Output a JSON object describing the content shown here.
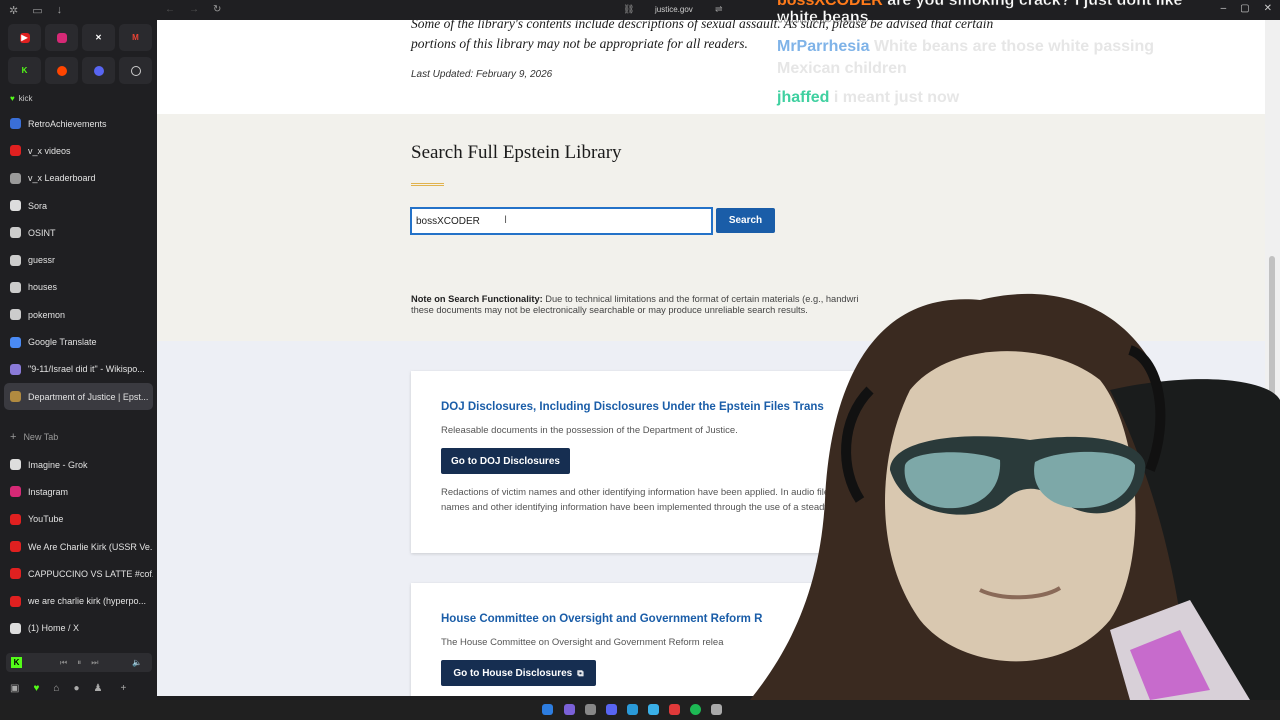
{
  "browser": {
    "url": "justice.gov"
  },
  "sidebar": {
    "kick_label": "kick",
    "tabs": [
      {
        "label": "RetroAchievements",
        "icon": "retroachievements-icon",
        "color": "#3a6fd8"
      },
      {
        "label": "v_x videos",
        "icon": "youtube-icon",
        "color": "#e02020"
      },
      {
        "label": "v_x Leaderboard",
        "icon": "leaderboard-icon",
        "color": "#9a9a9a"
      },
      {
        "label": "Sora",
        "icon": "sora-icon",
        "color": "#dddddd"
      },
      {
        "label": "OSINT",
        "icon": "folder-icon",
        "color": "#cccccc"
      },
      {
        "label": "guessr",
        "icon": "folder-icon",
        "color": "#cccccc"
      },
      {
        "label": "houses",
        "icon": "folder-icon",
        "color": "#cccccc"
      },
      {
        "label": "pokemon",
        "icon": "folder-icon",
        "color": "#cccccc"
      },
      {
        "label": "Google Translate",
        "icon": "google-translate-icon",
        "color": "#4a8af4"
      },
      {
        "label": "\"9-11/Israel did it\" - Wikispo...",
        "icon": "wiki-icon",
        "color": "#8a7ad8"
      },
      {
        "label": "Department of Justice | Epst...",
        "icon": "doj-icon",
        "color": "#b08a40"
      }
    ],
    "new_tab_label": "New Tab",
    "tabs2": [
      {
        "label": "Imagine - Grok",
        "icon": "grok-icon",
        "color": "#dddddd"
      },
      {
        "label": "Instagram",
        "icon": "instagram-icon",
        "color": "#d62976"
      },
      {
        "label": "YouTube",
        "icon": "youtube-icon",
        "color": "#e02020"
      },
      {
        "label": "We Are Charlie Kirk (USSR Ve...",
        "icon": "youtube-icon",
        "color": "#e02020"
      },
      {
        "label": "CAPPUCCINO VS LATTE #cof...",
        "icon": "youtube-icon",
        "color": "#e02020"
      },
      {
        "label": "we are charlie kirk (hyperpo...",
        "icon": "youtube-icon",
        "color": "#e02020"
      },
      {
        "label": "(1) Home / X",
        "icon": "x-icon",
        "color": "#dddddd"
      }
    ]
  },
  "page": {
    "intro_text": "Some of the library's contents include descriptions of sexual assault. As such, please be advised that certain portions of this library may not be appropriate for all readers.",
    "last_updated": "Last Updated: February 9, 2026",
    "search_title": "Search Full Epstein Library",
    "search_value": "bossXCODER",
    "search_button": "Search",
    "note_label": "Note on Search Functionality:",
    "note_text": " Due to technical limitations and the format of certain materials (e.g., handwri",
    "note_text2": "these documents may not be electronically searchable or may produce unreliable search results.",
    "card1": {
      "title": "DOJ Disclosures, Including Disclosures Under the Epstein Files Trans",
      "desc": "Releasable documents in the possession of the Department of Justice.",
      "button": "Go to DOJ Disclosures",
      "para1": "Redactions of victim names and other identifying information have been applied. In audio files",
      "para2": "names and other identifying information have been implemented through the use of a steady,"
    },
    "card2": {
      "title": "House Committee on Oversight and Government Reform R",
      "desc": "The House Committee on Oversight and Government Reform relea",
      "button": "Go to House Disclosures"
    }
  },
  "chat": {
    "line1_user": "bossXCODER",
    "line1_msg": " are you smoking crack? I just dont like",
    "line1b": "white beans",
    "line2_user": "MrParrhesia",
    "line2_msg": " White beans are those white passing",
    "line2b": "Mexican children",
    "line3_user": "jhaffed",
    "line3_msg": " i meant just now"
  }
}
